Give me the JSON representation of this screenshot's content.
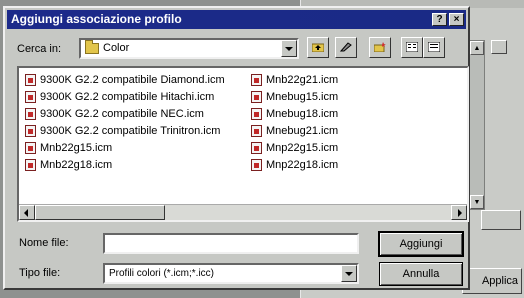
{
  "dialog": {
    "title": "Aggiungi associazione profilo",
    "help_button": "?",
    "close_button": "×"
  },
  "lookin": {
    "label": "Cerca in:",
    "value": "Color"
  },
  "files": {
    "column1": [
      "9300K G2.2 compatibile Diamond.icm",
      "9300K G2.2 compatibile Hitachi.icm",
      "9300K G2.2 compatibile NEC.icm",
      "9300K G2.2 compatibile Trinitron.icm",
      "Mnb22g15.icm",
      "Mnb22g18.icm"
    ],
    "column2": [
      "Mnb22g21.icm",
      "Mnebug15.icm",
      "Mnebug18.icm",
      "Mnebug21.icm",
      "Mnp22g15.icm",
      "Mnp22g18.icm"
    ]
  },
  "filename": {
    "label": "Nome file:",
    "value": ""
  },
  "filetype": {
    "label": "Tipo file:",
    "value": "Profili colori (*.icm;*.icc)"
  },
  "buttons": {
    "add": "Aggiungi",
    "cancel": "Annulla"
  },
  "background": {
    "applica": "Applica"
  },
  "colors": {
    "titlebar": "#1c2a8a",
    "face": "#c6c8c4"
  }
}
